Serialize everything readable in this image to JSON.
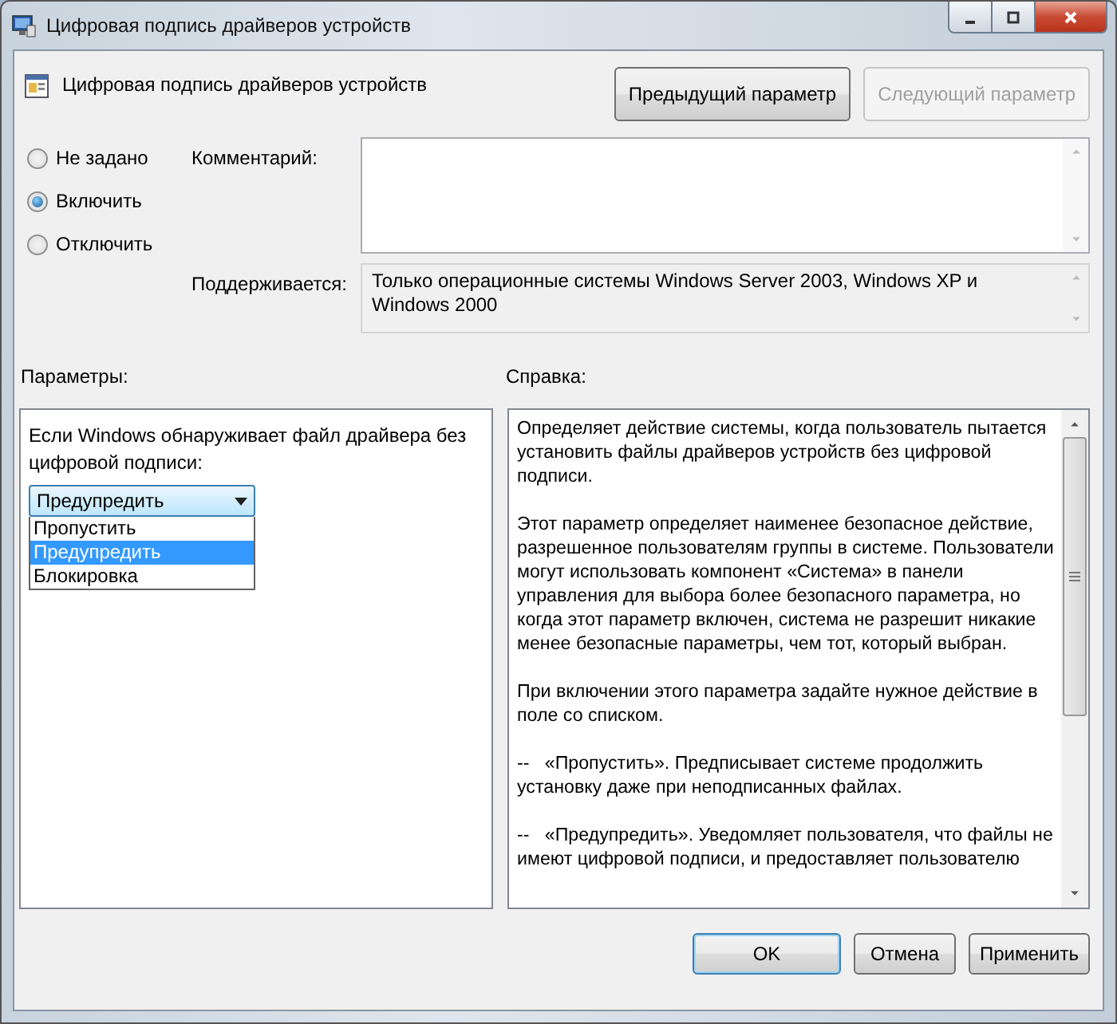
{
  "window": {
    "title": "Цифровая подпись драйверов устройств"
  },
  "header": {
    "title": "Цифровая подпись драйверов устройств",
    "buttons": [
      {
        "label": "Предыдущий параметр",
        "disabled": false
      },
      {
        "label": "Следующий параметр",
        "disabled": true
      }
    ]
  },
  "state_options": [
    {
      "label": "Не задано",
      "selected": false
    },
    {
      "label": "Включить",
      "selected": true
    },
    {
      "label": "Отключить",
      "selected": false
    }
  ],
  "comment": {
    "label": "Комментарий:"
  },
  "supported": {
    "label": "Поддерживается:",
    "value": "Только операционные системы Windows Server 2003, Windows XP и Windows 2000"
  },
  "options_panel": {
    "label": "Параметры:",
    "prompt": "Если Windows обнаруживает файл драйвера без цифровой подписи:",
    "dropdown": {
      "value": "Предупредить",
      "expanded": true,
      "items": [
        {
          "label": "Пропустить",
          "selected": false
        },
        {
          "label": "Предупредить",
          "selected": true
        },
        {
          "label": "Блокировка",
          "selected": false
        }
      ]
    }
  },
  "help_panel": {
    "label": "Справка:",
    "paragraphs": [
      "Определяет действие системы, когда пользователь пытается установить файлы драйверов устройств без цифровой подписи.",
      "Этот параметр определяет наименее безопасное действие, разрешенное пользователям группы в системе. Пользователи могут использовать компонент «Система» в панели управления для выбора более безопасного параметра, но когда этот параметр включен, система не разрешит никакие менее безопасные параметры, чем тот, который выбран.",
      "При включении этого параметра задайте нужное действие в поле со списком.",
      "--   «Пропустить». Предписывает системе продолжить установку даже при неподписанных файлах.",
      "--   «Предупредить». Уведомляет пользователя, что файлы не имеют цифровой подписи, и предоставляет пользователю"
    ]
  },
  "buttons": [
    {
      "label": "OK",
      "default": true
    },
    {
      "label": "Отмена",
      "default": false
    },
    {
      "label": "Применить",
      "default": false
    }
  ]
}
